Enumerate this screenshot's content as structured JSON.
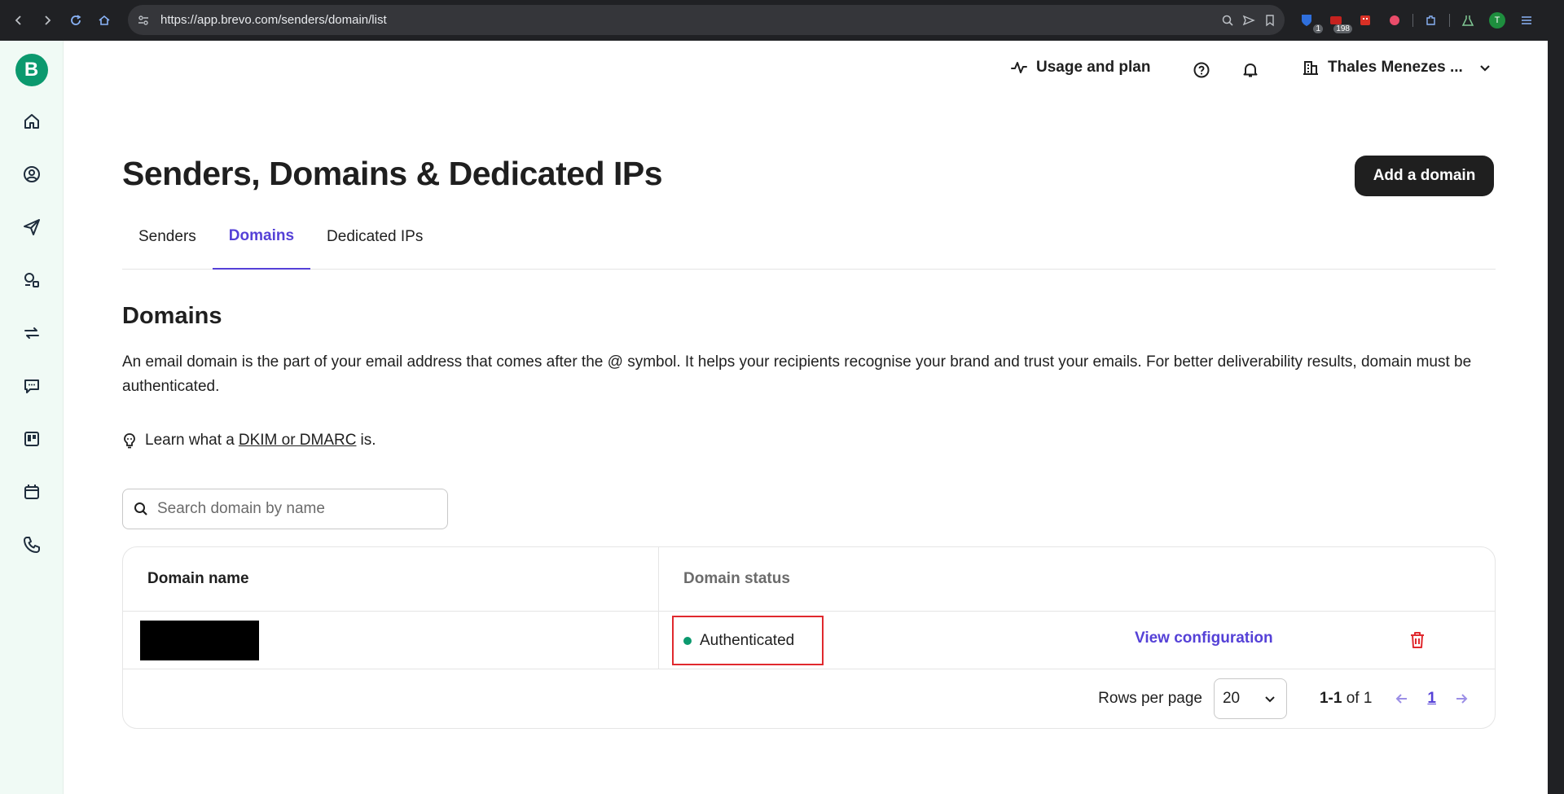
{
  "browser": {
    "url": "https://app.brevo.com/senders/domain/list",
    "ext_badge_1": "1",
    "ext_badge_2": "198",
    "profile_initial": "T"
  },
  "sidebar": {
    "logo": "B",
    "items": [
      "home-icon",
      "contacts-icon",
      "campaigns-icon",
      "automations-icon",
      "transactional-icon",
      "conversations-icon",
      "deals-icon",
      "meetings-icon",
      "phone-icon"
    ]
  },
  "topbar": {
    "usage_label": "Usage and plan",
    "account_name": "Thales Menezes ..."
  },
  "page": {
    "title": "Senders, Domains & Dedicated IPs",
    "add_button": "Add a domain",
    "tabs": [
      {
        "label": "Senders",
        "active": false
      },
      {
        "label": "Domains",
        "active": true
      },
      {
        "label": "Dedicated IPs",
        "active": false
      }
    ]
  },
  "domains": {
    "title": "Domains",
    "description": "An email domain is the part of your email address that comes after the @ symbol. It helps your recipients recognise your brand and trust your emails. For better deliverability results, domain must be authenticated.",
    "learn_prefix": "Learn what a",
    "learn_link": "DKIM or DMARC",
    "learn_suffix": "is.",
    "search_placeholder": "Search domain by name"
  },
  "table": {
    "col_name": "Domain name",
    "col_status": "Domain status",
    "rows": [
      {
        "name": "",
        "status": "Authenticated",
        "action": "View configuration"
      }
    ],
    "rows_per_page_label": "Rows per page",
    "rows_per_page": "20",
    "range_bold": "1-1",
    "range_rest": "of 1",
    "page": "1"
  },
  "colors": {
    "accent": "#5541d7",
    "brand": "#0b996e",
    "danger": "#e0292e"
  }
}
